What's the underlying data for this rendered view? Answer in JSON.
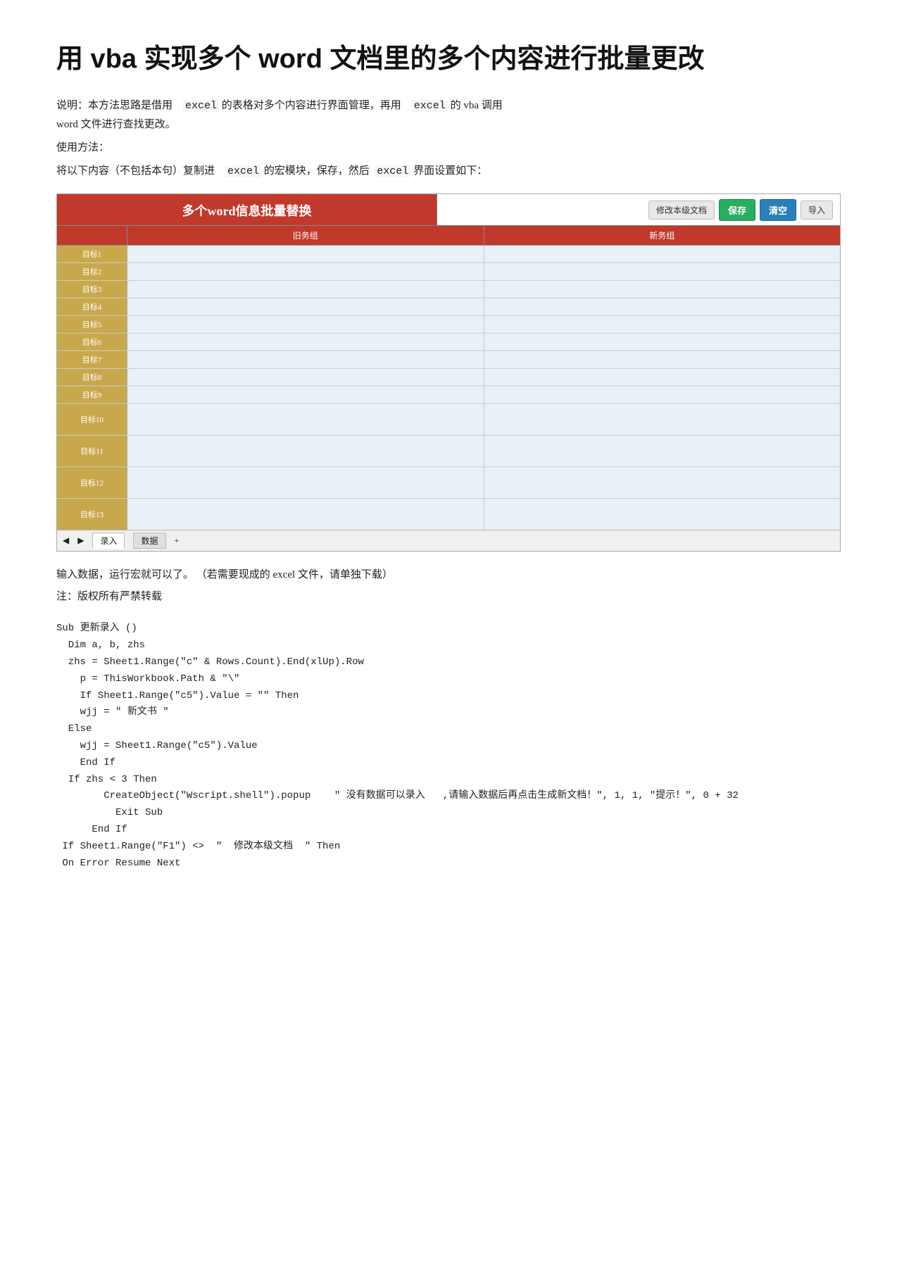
{
  "title": "用 vba 实现多个 word 文档里的多个内容进行批量更改",
  "intro": {
    "line1": "说明：本方法思路是借用",
    "excel1": "excel",
    "line1b": "的表格对多个内容进行界面管理，再用",
    "excel2": "excel",
    "line1c": "的 vba 调用",
    "line2": "word 文件进行查找更改。",
    "line3": "使用方法：",
    "line4a": "将以下内容（不包括本句）复制进",
    "excel3": "excel",
    "line4b": "的宏模块，保存，然后",
    "excel4": "excel",
    "line4c": "界面设置如下："
  },
  "spreadsheet": {
    "title": "多个word信息批量替换",
    "btn_xiugai": "修改本级文档",
    "btn_baocun": "保存",
    "btn_qingkong": "清空",
    "btn_daoru": "导入",
    "col_label": "",
    "col_jiuneir": "旧务组",
    "col_xinneir": "新务组",
    "rows": [
      {
        "label": "目标1",
        "tall": false
      },
      {
        "label": "目标2",
        "tall": false
      },
      {
        "label": "目标3",
        "tall": false
      },
      {
        "label": "目标4",
        "tall": false
      },
      {
        "label": "目标5",
        "tall": false
      },
      {
        "label": "目标6",
        "tall": false
      },
      {
        "label": "目标7",
        "tall": false
      },
      {
        "label": "目标8",
        "tall": false
      },
      {
        "label": "目标9",
        "tall": false
      },
      {
        "label": "目标10",
        "tall": true
      },
      {
        "label": "目标11",
        "tall": true
      },
      {
        "label": "目标12",
        "tall": true
      },
      {
        "label": "目标13",
        "tall": true
      }
    ],
    "tab_input": "录入",
    "tab_data": "数据"
  },
  "footer_note": "输入数据，运行宏就可以了。    （若需要现成的  excel 文件，请单独下载）",
  "copyright_note": "注：版权所有严禁转载",
  "code": {
    "lines": [
      "Sub 更新录入 ()",
      "  Dim a, b, zhs",
      "  zhs = Sheet1.Range(\"c\" & Rows.Count).End(xlUp).Row",
      "    p = ThisWorkbook.Path & \"\\\"",
      "    If Sheet1.Range(\"c5\").Value = \"\" Then",
      "    wjj = \" 新文书 \"",
      "  Else",
      "    wjj = Sheet1.Range(\"c5\").Value",
      "    End If",
      "  If zhs < 3 Then",
      "        CreateObject(\"Wscript.shell\").popup    \" 没有数据可以录入   ,请输入数据后再点击生成新文档！\", 1, 1, \"提示！\", 0 + 32",
      "          Exit Sub",
      "      End If",
      " If Sheet1.Range(\"F1\") <>  \"  修改本级文档  \" Then",
      " On Error Resume Next"
    ]
  }
}
